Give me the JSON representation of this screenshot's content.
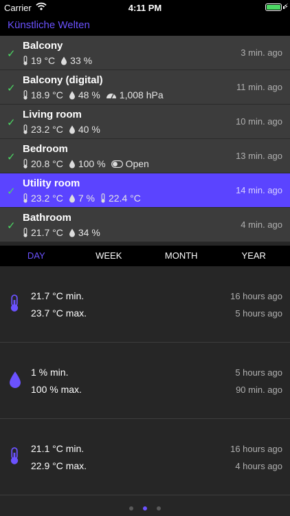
{
  "status": {
    "carrier": "Carrier",
    "time": "4:11 PM"
  },
  "app": {
    "title": "Künstliche Welten",
    "accent": "#5b44ff"
  },
  "sensors": [
    {
      "name": "Balcony",
      "temp": "19 °C",
      "humidity": "33 %",
      "time": "3 min. ago"
    },
    {
      "name": "Balcony (digital)",
      "temp": "18.9 °C",
      "humidity": "48 %",
      "pressure": "1,008 hPa",
      "time": "11 min. ago"
    },
    {
      "name": "Living room",
      "temp": "23.2 °C",
      "humidity": "40 %",
      "time": "10 min. ago"
    },
    {
      "name": "Bedroom",
      "temp": "20.8 °C",
      "humidity": "100 %",
      "window": "Open",
      "time": "13 min. ago"
    },
    {
      "name": "Utility room",
      "temp": "23.2 °C",
      "humidity": "7 %",
      "temp2": "22.4 °C",
      "time": "14 min. ago"
    },
    {
      "name": "Bathroom",
      "temp": "21.7 °C",
      "humidity": "34 %",
      "time": "4 min. ago"
    }
  ],
  "tabs": [
    "DAY",
    "WEEK",
    "MONTH",
    "YEAR"
  ],
  "stats": [
    {
      "icon": "thermometer-icon",
      "min": "21.7 °C min.",
      "max": "23.7 °C max.",
      "min_time": "16 hours ago",
      "max_time": "5 hours ago"
    },
    {
      "icon": "droplet-icon",
      "min": "1 % min.",
      "max": "100 % max.",
      "min_time": "5 hours ago",
      "max_time": "90 min. ago"
    },
    {
      "icon": "thermometer-icon",
      "min": "21.1 °C min.",
      "max": "22.9 °C max.",
      "min_time": "16 hours ago",
      "max_time": "4 hours ago"
    }
  ]
}
